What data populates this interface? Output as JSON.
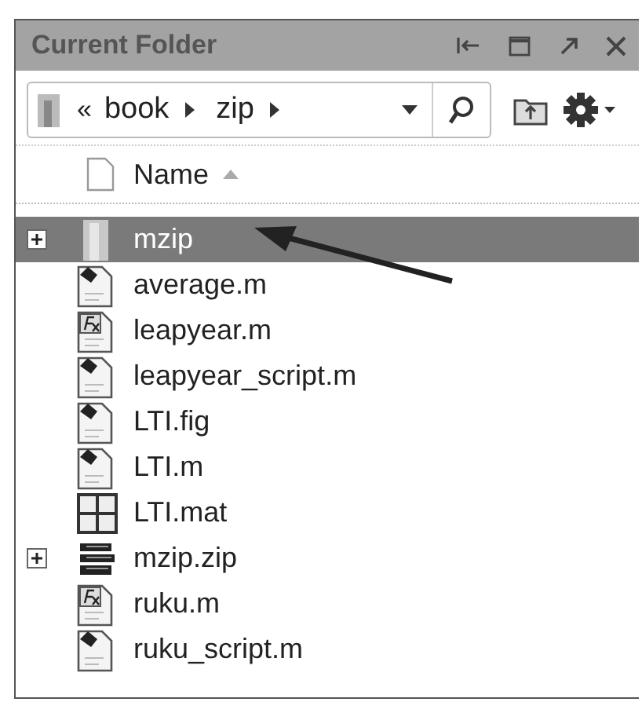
{
  "window": {
    "title": "Current Folder"
  },
  "address": {
    "prefix": "«",
    "crumbs": [
      {
        "label": "book"
      },
      {
        "label": "zip"
      }
    ]
  },
  "header": {
    "label": "Name",
    "sort_ascending": true
  },
  "files": [
    {
      "name": "mzip",
      "kind": "folder",
      "expandable": true,
      "selected": true
    },
    {
      "name": "average.m",
      "kind": "script",
      "expandable": false,
      "selected": false
    },
    {
      "name": "leapyear.m",
      "kind": "function",
      "expandable": false,
      "selected": false
    },
    {
      "name": "leapyear_script.m",
      "kind": "script",
      "expandable": false,
      "selected": false
    },
    {
      "name": "LTI.fig",
      "kind": "script",
      "expandable": false,
      "selected": false
    },
    {
      "name": "LTI.m",
      "kind": "script",
      "expandable": false,
      "selected": false
    },
    {
      "name": "LTI.mat",
      "kind": "matfile",
      "expandable": false,
      "selected": false
    },
    {
      "name": "mzip.zip",
      "kind": "zip",
      "expandable": true,
      "selected": false
    },
    {
      "name": "ruku.m",
      "kind": "function",
      "expandable": false,
      "selected": false
    },
    {
      "name": "ruku_script.m",
      "kind": "script",
      "expandable": false,
      "selected": false
    }
  ]
}
